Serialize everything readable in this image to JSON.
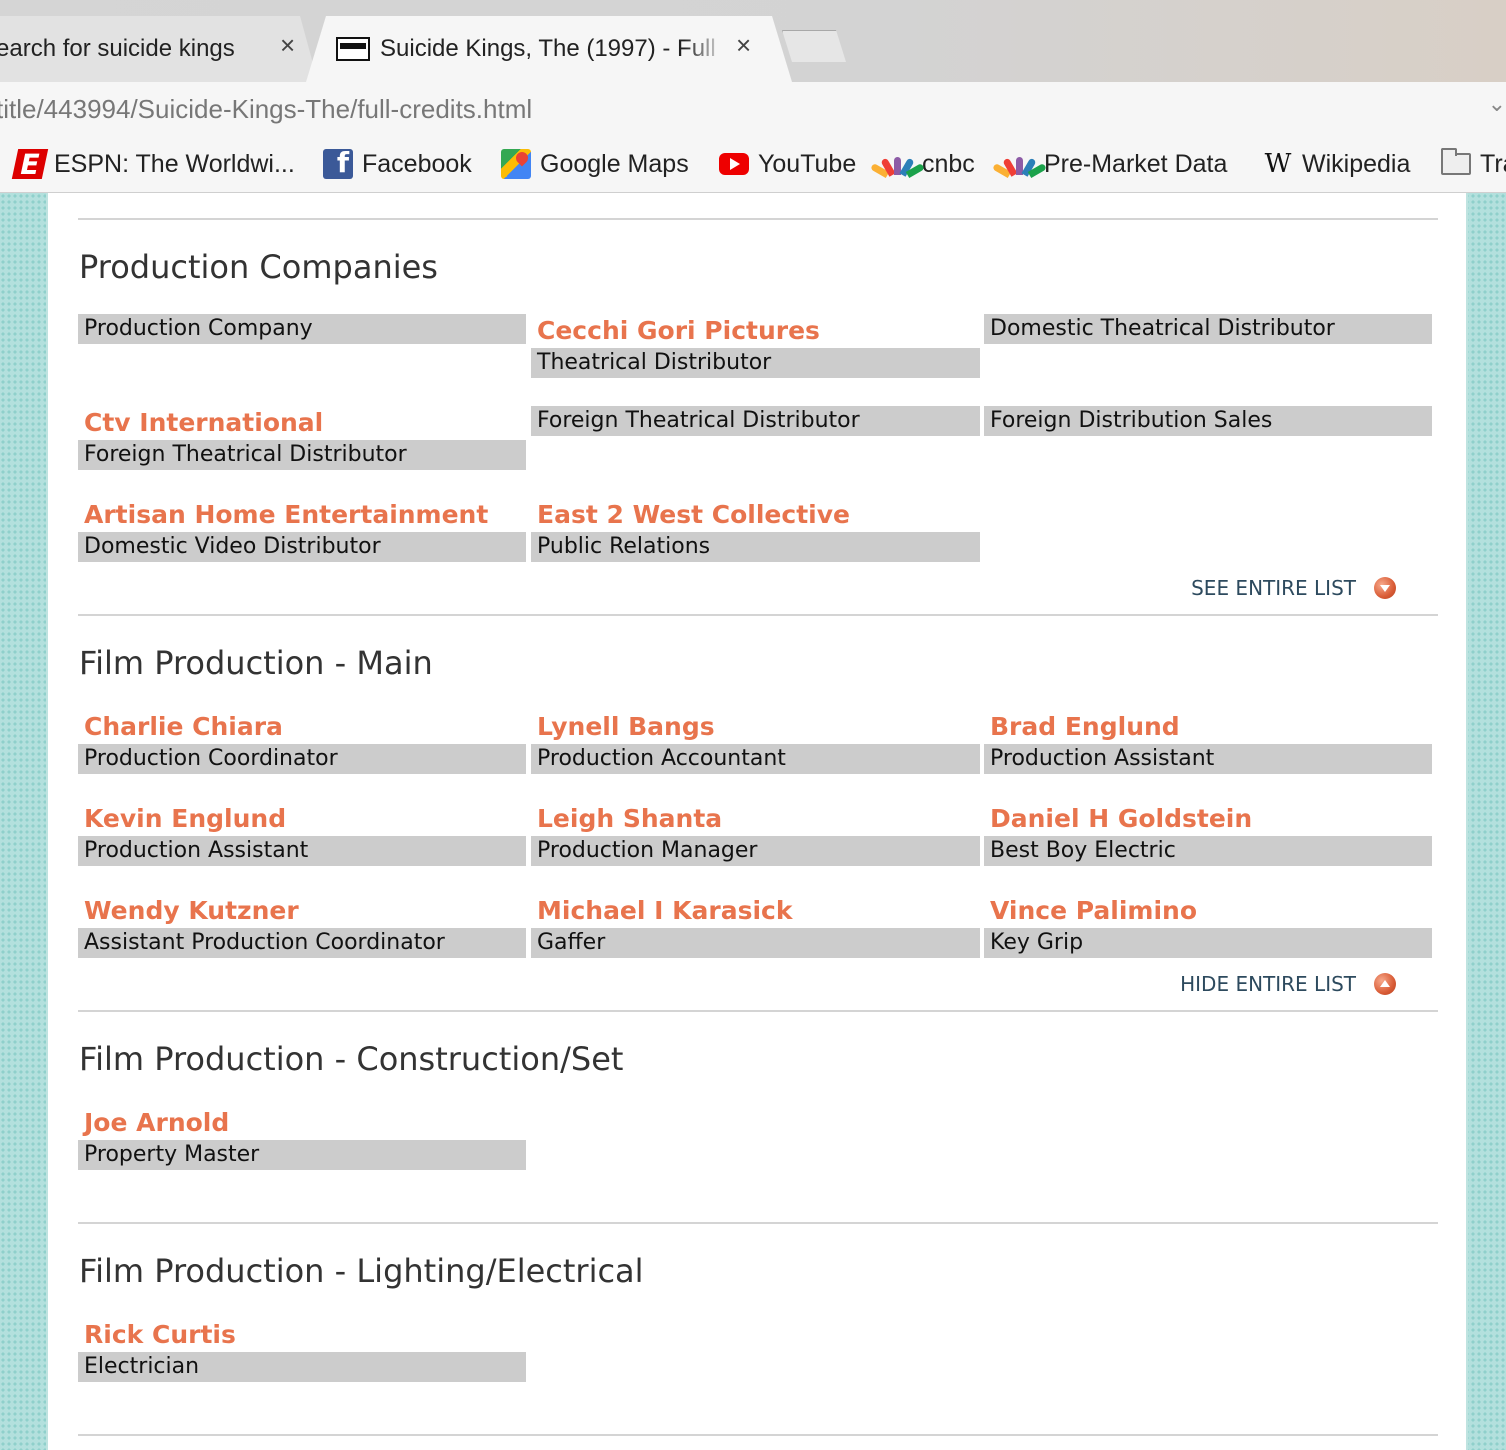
{
  "browser": {
    "tabs": [
      {
        "title": "earch for suicide kings",
        "close": "×"
      },
      {
        "title": "Suicide Kings, The (1997) - Full",
        "close": "×"
      }
    ],
    "url": "title/443994/Suicide-Kings-The/full-credits.html",
    "bookmarks": [
      {
        "label": "ESPN: The Worldwi...",
        "icon": "espn-icon"
      },
      {
        "label": "Facebook",
        "icon": "facebook-icon"
      },
      {
        "label": "Google Maps",
        "icon": "google-maps-icon"
      },
      {
        "label": "YouTube",
        "icon": "youtube-icon"
      },
      {
        "label": "cnbc",
        "icon": "nbc-peacock-icon"
      },
      {
        "label": "Pre-Market Data",
        "icon": "nbc-peacock-icon"
      },
      {
        "label": "Wikipedia",
        "icon": "wikipedia-icon"
      },
      {
        "label": "Tra",
        "icon": "folder-icon"
      }
    ]
  },
  "colors": {
    "accent": "#e8744d",
    "role_bg": "#cccccc",
    "link_dark": "#2d4a5e"
  },
  "sections": [
    {
      "title": "Production Companies",
      "toggle": "SEE ENTIRE LIST",
      "rows": [
        [
          {
            "name": "",
            "role": "Production Company"
          },
          {
            "name": "Cecchi Gori Pictures",
            "role": "Theatrical Distributor"
          },
          {
            "name": "",
            "role": "Domestic Theatrical Distributor"
          }
        ],
        [
          {
            "name": "Ctv International",
            "role": "Foreign Theatrical Distributor"
          },
          {
            "name": "",
            "role": "Foreign Theatrical Distributor"
          },
          {
            "name": "",
            "role": "Foreign Distribution Sales"
          }
        ],
        [
          {
            "name": "Artisan Home Entertainment",
            "role": "Domestic Video Distributor"
          },
          {
            "name": "East 2 West Collective",
            "role": "Public Relations"
          }
        ]
      ]
    },
    {
      "title": "Film Production - Main",
      "toggle": "HIDE ENTIRE LIST",
      "rows": [
        [
          {
            "name": "Charlie Chiara",
            "role": "Production Coordinator"
          },
          {
            "name": "Lynell Bangs",
            "role": "Production Accountant"
          },
          {
            "name": "Brad Englund",
            "role": "Production Assistant"
          }
        ],
        [
          {
            "name": "Kevin Englund",
            "role": "Production Assistant"
          },
          {
            "name": "Leigh Shanta",
            "role": "Production Manager"
          },
          {
            "name": "Daniel H Goldstein",
            "role": "Best Boy Electric"
          }
        ],
        [
          {
            "name": "Wendy Kutzner",
            "role": "Assistant Production Coordinator"
          },
          {
            "name": "Michael I Karasick",
            "role": "Gaffer"
          },
          {
            "name": "Vince Palimino",
            "role": "Key Grip"
          }
        ]
      ]
    },
    {
      "title": "Film Production - Construction/Set",
      "rows": [
        [
          {
            "name": "Joe Arnold",
            "role": "Property Master"
          }
        ]
      ]
    },
    {
      "title": "Film Production - Lighting/Electrical",
      "rows": [
        [
          {
            "name": "Rick Curtis",
            "role": "Electrician"
          }
        ]
      ]
    }
  ]
}
